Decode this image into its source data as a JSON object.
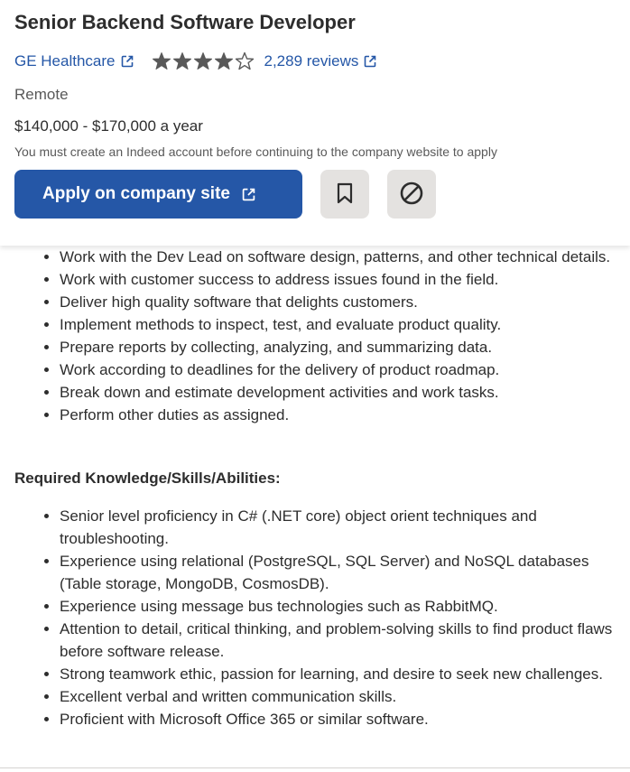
{
  "job": {
    "title": "Senior Backend Software Developer",
    "company": "GE Healthcare",
    "rating_value": 4,
    "rating_max": 5,
    "reviews_label": "2,289 reviews",
    "location": "Remote",
    "salary": "$140,000 - $170,000 a year",
    "notice": "You must create an Indeed account before continuing to the company website to apply"
  },
  "actions": {
    "apply_label": "Apply on company site",
    "save_icon": "bookmark-icon",
    "not_interested_icon": "block-icon"
  },
  "description": {
    "duties": [
      "Work with the Dev Lead on software design, patterns, and other technical details.",
      "Work with customer success to address issues found in the field.",
      "Deliver high quality software that delights customers.",
      "Implement methods to inspect, test, and evaluate product quality.",
      "Prepare reports by collecting, analyzing, and summarizing data.",
      "Work according to deadlines for the delivery of product roadmap.",
      "Break down and estimate development activities and work tasks.",
      "Perform other duties as assigned."
    ],
    "skills_heading": "Required Knowledge/Skills/Abilities:",
    "skills": [
      "Senior level proficiency in C# (.NET core) object orient techniques and troubleshooting.",
      "Experience using relational (PostgreSQL, SQL Server) and NoSQL databases (Table storage, MongoDB, CosmosDB).",
      "Experience using message bus technologies such as RabbitMQ.",
      "Attention to detail, critical thinking, and problem-solving skills to find product flaws before software release.",
      "Strong teamwork ethic, passion for learning, and desire to seek new challenges.",
      "Excellent verbal and written communication skills.",
      "Proficient with Microsoft Office 365 or similar software."
    ]
  },
  "colors": {
    "brand_blue": "#2557a7",
    "text": "#2d2d2d",
    "muted_text": "#595959",
    "icon_button_bg": "#e4e2e0"
  }
}
